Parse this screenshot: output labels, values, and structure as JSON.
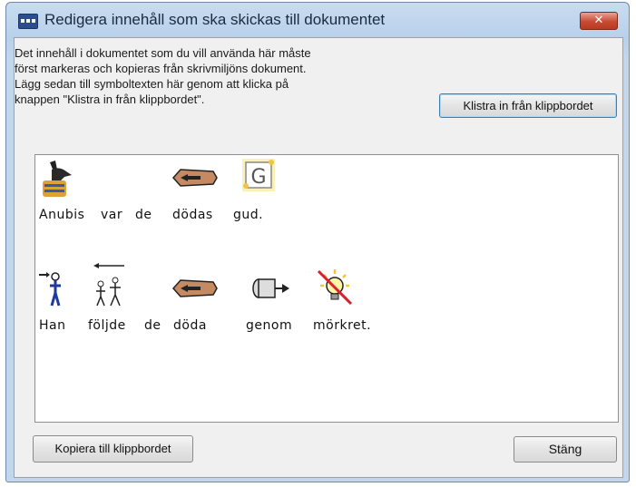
{
  "window": {
    "title": "Redigera innehåll som ska skickas till dokumentet",
    "close_glyph": "✕"
  },
  "instructions": "Det innehåll i dokumentet som du vill använda här måste\nförst markeras och kopieras från skrivmiljöns dokument.\nLägg sedan till symboltexten här genom att klicka på\nknappen \"Klistra in från klippbordet\".",
  "buttons": {
    "paste": "Klistra in från klippbordet",
    "copy": "Kopiera till klippbordet",
    "close": "Stäng"
  },
  "editor": {
    "line1": [
      "Anubis",
      "var",
      "de",
      "dödas",
      "gud."
    ],
    "line2": [
      "Han",
      "följde",
      "de",
      "döda",
      "genom",
      "mörkret."
    ],
    "line1_symbols": [
      "anubis-symbol-icon",
      "coffin-symbol-icon",
      "god-symbol-icon"
    ],
    "line2_symbols": [
      "person-symbol-icon",
      "follow-symbol-icon",
      "coffin-symbol-icon",
      "through-symbol-icon",
      "no-light-symbol-icon"
    ]
  },
  "colors": {
    "titlebar": "#c2d7ee",
    "close_button": "#c74a33",
    "client_background": "#f0f0f0",
    "focus_border": "#3c7fb1"
  }
}
